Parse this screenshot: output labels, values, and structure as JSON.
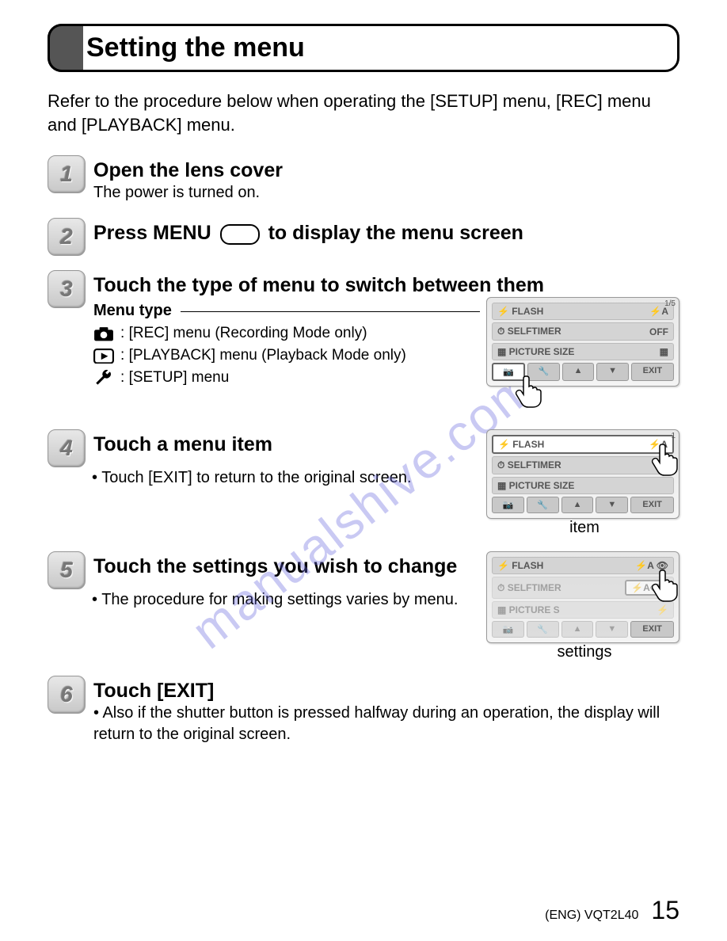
{
  "title": "Setting the menu",
  "intro": "Refer to the procedure below when operating the [SETUP] menu, [REC] menu and [PLAYBACK] menu.",
  "watermark": "manualshive.com",
  "steps": [
    {
      "num": "1",
      "title": "Open the lens cover",
      "body": "The power is turned on."
    },
    {
      "num": "2",
      "title_before": "Press MENU",
      "title_after": "to display the menu screen"
    },
    {
      "num": "3",
      "title": "Touch the type of menu to switch between them",
      "subtitle": "Menu type",
      "menu_types": [
        {
          "label": "[REC] menu (Recording Mode only)"
        },
        {
          "label": "[PLAYBACK] menu (Playback Mode only)"
        },
        {
          "label": "[SETUP] menu"
        }
      ]
    },
    {
      "num": "4",
      "title": "Touch a menu item",
      "body": "• Touch [EXIT] to return to the original screen.",
      "screen_label": "item"
    },
    {
      "num": "5",
      "title": "Touch the settings you wish to change",
      "body": "• The procedure for making settings varies by menu.",
      "screen_label": "settings"
    },
    {
      "num": "6",
      "title": "Touch [EXIT]",
      "body": "• Also if the shutter button is pressed halfway during an operation, the display will return to the original screen."
    }
  ],
  "screens": {
    "s3": {
      "rows": [
        {
          "l": "⚡ FLASH",
          "r": "⚡A"
        },
        {
          "l": "⏱ SELFTIMER",
          "r": "OFF"
        },
        {
          "l": "▦ PICTURE SIZE",
          "r": "▦"
        }
      ],
      "page": "1/5",
      "buttons": [
        "📷",
        "🔧",
        "▲",
        "▼",
        "EXIT"
      ]
    },
    "s4": {
      "rows": [
        {
          "l": "⚡ FLASH",
          "r": "⚡A"
        },
        {
          "l": "⏱ SELFTIMER",
          "r": ""
        },
        {
          "l": "▦ PICTURE SIZE",
          "r": ""
        }
      ],
      "page": "1",
      "buttons": [
        "📷",
        "🔧",
        "▲",
        "▼",
        "EXIT"
      ]
    },
    "s5": {
      "rows": [
        {
          "l": "⚡ FLASH",
          "r": "⚡A  👁"
        },
        {
          "l": "⏱ SELFTIMER",
          "r": "⚡A👁"
        },
        {
          "l": "▦ PICTURE S",
          "r": "⚡"
        }
      ],
      "buttons": [
        "📷",
        "🔧",
        "▲",
        "▼",
        "EXIT"
      ]
    }
  },
  "footer": {
    "code": "(ENG) VQT2L40",
    "page": "15"
  }
}
